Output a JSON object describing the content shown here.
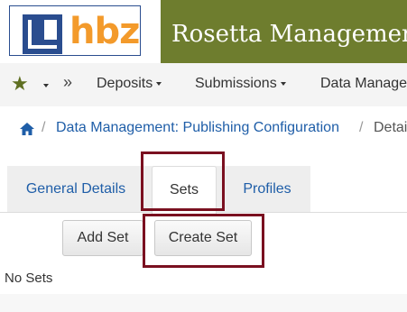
{
  "header": {
    "logo_text": "hbz",
    "app_title": "Rosetta Management"
  },
  "nav": {
    "favorites_icon": "star-icon",
    "more_icon": "double-chevron-right-icon",
    "items": [
      {
        "label": "Deposits"
      },
      {
        "label": "Submissions"
      },
      {
        "label": "Data Manage"
      }
    ]
  },
  "breadcrumb": {
    "home_icon": "home-icon",
    "items": [
      {
        "label": "Data Management: Publishing Configuration"
      },
      {
        "label": "Detai"
      }
    ],
    "separator": "/"
  },
  "tabs": [
    {
      "label": "General Details",
      "active": false
    },
    {
      "label": "Sets",
      "active": true
    },
    {
      "label": "Profiles",
      "active": false
    }
  ],
  "actions": {
    "add_set": "Add Set",
    "create_set": "Create Set"
  },
  "content": {
    "empty_message": "No Sets"
  },
  "colors": {
    "brand_green": "#6e7d2e",
    "logo_orange": "#f39a2b",
    "logo_blue": "#2a4d8f",
    "link_blue": "#1f5ea8",
    "highlight": "#7a1020"
  }
}
